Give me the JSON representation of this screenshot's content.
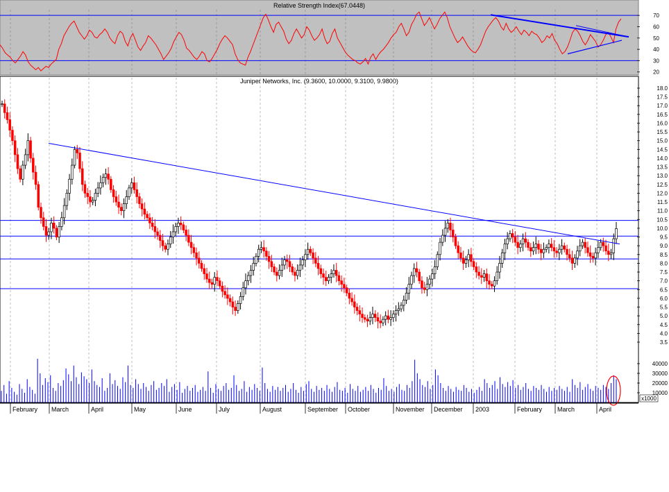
{
  "colors": {
    "background": "#ffffff",
    "rsi_panel_bg": "#c0c0c0",
    "rsi_line": "#ff0000",
    "blue_line": "#0000ff",
    "grid": "#a0a0a0",
    "candle_up": "#000000",
    "candle_down": "#ff0000",
    "volume_bar": "#0000ff",
    "highlight_ellipse": "#ff0000"
  },
  "chart_data": [
    {
      "type": "line",
      "title": "Relative Strength Index(67.0448)",
      "ylim": [
        18,
        75
      ],
      "y_ticks": [
        "70",
        "60",
        "50",
        "40",
        "30",
        "20"
      ],
      "y_tick_values": [
        70,
        60,
        50,
        40,
        30,
        20
      ],
      "reference_levels": [
        70,
        30
      ],
      "series": [
        {
          "values": [
            44,
            41,
            37,
            35,
            33,
            30,
            28,
            31,
            34,
            38,
            35,
            29,
            26,
            24,
            22,
            24,
            21,
            23,
            25,
            24,
            27,
            29,
            31,
            40,
            45,
            52,
            56,
            60,
            63,
            65,
            60,
            55,
            52,
            49,
            52,
            57,
            55,
            51,
            50,
            53,
            55,
            58,
            55,
            50,
            47,
            45,
            52,
            56,
            54,
            47,
            43,
            50,
            54,
            48,
            42,
            39,
            43,
            46,
            52,
            50,
            47,
            44,
            40,
            36,
            31,
            34,
            37,
            41,
            47,
            51,
            55,
            53,
            48,
            41,
            39,
            36,
            33,
            31,
            34,
            38,
            36,
            30,
            29,
            32,
            36,
            40,
            45,
            49,
            52,
            50,
            47,
            44,
            36,
            31,
            28,
            27,
            26,
            33,
            38,
            44,
            50,
            56,
            62,
            68,
            71,
            66,
            60,
            55,
            62,
            64,
            60,
            56,
            49,
            45,
            48,
            54,
            58,
            54,
            50,
            53,
            60,
            57,
            52,
            48,
            50,
            53,
            58,
            50,
            45,
            47,
            54,
            58,
            50,
            46,
            42,
            38,
            35,
            33,
            31,
            30,
            28,
            27,
            29,
            32,
            27,
            33,
            36,
            31,
            35,
            38,
            40,
            43,
            46,
            50,
            53,
            55,
            60,
            63,
            58,
            52,
            55,
            62,
            66,
            71,
            73,
            67,
            61,
            64,
            68,
            63,
            58,
            62,
            67,
            70,
            73,
            68,
            60,
            55,
            50,
            46,
            48,
            51,
            47,
            43,
            40,
            38,
            37,
            40,
            44,
            50,
            56,
            60,
            63,
            66,
            68,
            65,
            60,
            57,
            63,
            58,
            55,
            57,
            60,
            56,
            53,
            57,
            55,
            52,
            56,
            54,
            53,
            50,
            46,
            48,
            52,
            50,
            54,
            48,
            45,
            40,
            36,
            38,
            42,
            48,
            55,
            58,
            56,
            52,
            47,
            44,
            48,
            53,
            50,
            47,
            42,
            44,
            48,
            53,
            55,
            51,
            46,
            58,
            64,
            67
          ],
          "color": "#ff0000"
        }
      ]
    },
    {
      "type": "line",
      "title": "Juniper Networks, Inc. (9.3600, 10.0000, 9.3100, 9.9800)",
      "xlabel": "",
      "ylabel": "",
      "ylim": [
        3.0,
        18.5
      ],
      "y_ticks": [
        "18.0",
        "17.5",
        "17.0",
        "16.5",
        "16.0",
        "15.5",
        "15.0",
        "14.5",
        "14.0",
        "13.5",
        "13.0",
        "12.5",
        "12.0",
        "11.5",
        "11.0",
        "10.5",
        "10.0",
        "9.5",
        "9.0",
        "8.5",
        "8.0",
        "7.5",
        "7.0",
        "6.5",
        "6.0",
        "5.5",
        "5.0",
        "4.5",
        "4.0",
        "3.5"
      ],
      "y_tick_values": [
        18.0,
        17.5,
        17.0,
        16.5,
        16.0,
        15.5,
        15.0,
        14.5,
        14.0,
        13.5,
        13.0,
        12.5,
        12.0,
        11.5,
        11.0,
        10.5,
        10.0,
        9.5,
        9.0,
        8.5,
        8.0,
        7.5,
        7.0,
        6.5,
        6.0,
        5.5,
        5.0,
        4.5,
        4.0,
        3.5
      ],
      "x_ticks": [
        "February",
        "March",
        "April",
        "May",
        "June",
        "July",
        "August",
        "September",
        "October",
        "November",
        "December",
        "2003",
        "February",
        "March",
        "April"
      ],
      "horizontal_levels": [
        10.45,
        9.55,
        8.25,
        6.55
      ],
      "series": [
        {
          "name": "",
          "close": [
            17.1,
            16.6,
            16.2,
            15.6,
            15.0,
            14.2,
            13.4,
            12.8,
            13.6,
            14.2,
            15.0,
            14.0,
            13.2,
            12.5,
            11.2,
            10.6,
            10.1,
            9.6,
            9.8,
            10.3,
            10.0,
            9.5,
            10.1,
            10.6,
            11.3,
            12.0,
            12.8,
            13.6,
            14.5,
            14.3,
            13.4,
            12.5,
            12.0,
            11.8,
            11.5,
            11.6,
            12.0,
            12.3,
            12.6,
            12.9,
            13.1,
            12.8,
            12.2,
            11.8,
            11.5,
            11.2,
            11.0,
            11.4,
            11.8,
            12.3,
            12.6,
            12.2,
            11.8,
            11.4,
            11.1,
            10.8,
            10.6,
            10.3,
            10.1,
            9.8,
            9.6,
            9.3,
            9.0,
            8.8,
            9.1,
            9.5,
            9.8,
            10.1,
            10.3,
            10.2,
            9.9,
            9.6,
            9.2,
            8.9,
            8.6,
            8.3,
            8.0,
            7.7,
            7.4,
            7.1,
            6.9,
            6.8,
            7.2,
            7.0,
            6.7,
            6.4,
            6.2,
            6.0,
            5.8,
            5.5,
            5.3,
            5.7,
            6.1,
            6.6,
            7.0,
            7.3,
            7.6,
            8.0,
            8.4,
            8.8,
            8.9,
            8.7,
            8.4,
            8.1,
            7.8,
            7.5,
            7.3,
            7.6,
            7.9,
            8.2,
            8.1,
            7.8,
            7.5,
            7.3,
            7.6,
            7.9,
            8.2,
            8.5,
            8.8,
            8.6,
            8.3,
            8.0,
            7.7,
            7.4,
            7.2,
            7.0,
            7.2,
            7.4,
            7.6,
            7.3,
            7.0,
            6.8,
            6.6,
            6.3,
            6.0,
            5.8,
            5.5,
            5.3,
            5.1,
            4.9,
            4.8,
            4.7,
            4.9,
            5.1,
            4.9,
            4.7,
            4.6,
            4.8,
            5.0,
            4.8,
            4.9,
            5.1,
            5.3,
            5.4,
            5.6,
            5.9,
            6.3,
            6.8,
            7.3,
            7.7,
            7.5,
            7.0,
            6.6,
            6.5,
            6.8,
            7.1,
            7.4,
            7.8,
            8.5,
            9.2,
            9.6,
            10.0,
            10.3,
            9.9,
            9.5,
            9.0,
            8.6,
            8.3,
            8.0,
            8.2,
            8.5,
            8.1,
            7.8,
            7.5,
            7.3,
            7.2,
            7.4,
            7.0,
            6.8,
            6.7,
            7.0,
            7.5,
            8.0,
            8.6,
            9.1,
            9.4,
            9.7,
            9.5,
            9.2,
            8.9,
            9.1,
            9.4,
            9.2,
            8.9,
            8.7,
            8.9,
            9.1,
            8.8,
            8.6,
            8.8,
            8.9,
            9.1,
            8.9,
            8.7,
            8.6,
            8.8,
            9.0,
            8.8,
            8.5,
            8.3,
            8.0,
            8.3,
            8.7,
            9.0,
            9.2,
            8.9,
            8.6,
            8.4,
            8.3,
            8.6,
            8.9,
            9.2,
            9.0,
            8.7,
            8.5,
            8.6,
            9.4,
            9.98
          ],
          "color": "#000000"
        }
      ],
      "trendline": {
        "from_value": 14.85,
        "to_value": 9.1
      }
    },
    {
      "type": "bar",
      "title": "",
      "y_ticks": [
        "40000",
        "30000",
        "20000",
        "10000"
      ],
      "y_tick_values": [
        40000,
        30000,
        20000,
        10000
      ],
      "ylim": [
        0,
        50000
      ],
      "unit_label": "x1000",
      "values": [
        12000,
        18000,
        9000,
        22000,
        15000,
        11000,
        8000,
        19000,
        14000,
        10000,
        24000,
        16000,
        13000,
        9000,
        45000,
        30000,
        18000,
        25000,
        21000,
        28000,
        15000,
        12000,
        20000,
        17000,
        23000,
        35000,
        29000,
        22000,
        38000,
        26000,
        19000,
        31000,
        27000,
        24000,
        20000,
        34000,
        22000,
        18000,
        16000,
        25000,
        12000,
        15000,
        30000,
        19000,
        23000,
        17000,
        14000,
        26000,
        21000,
        38000,
        18000,
        15000,
        24000,
        19000,
        14000,
        20000,
        16000,
        12000,
        18000,
        22000,
        13000,
        15000,
        20000,
        17000,
        24000,
        11000,
        16000,
        19000,
        13000,
        21000,
        10000,
        14000,
        17000,
        12000,
        15000,
        18000,
        11000,
        13000,
        16000,
        12000,
        32000,
        15000,
        10000,
        19000,
        14000,
        12000,
        17000,
        20000,
        13000,
        15000,
        28000,
        18000,
        12000,
        14000,
        22000,
        11000,
        16000,
        13000,
        19000,
        15000,
        12000,
        36000,
        20000,
        14000,
        11000,
        17000,
        13000,
        16000,
        12000,
        15000,
        18000,
        11000,
        14000,
        20000,
        13000,
        10000,
        16000,
        12000,
        19000,
        22000,
        14000,
        11000,
        17000,
        13000,
        15000,
        12000,
        18000,
        14000,
        11000,
        16000,
        21000,
        13000,
        12000,
        15000,
        10000,
        19000,
        14000,
        12000,
        17000,
        11000,
        13000,
        16000,
        12000,
        18000,
        14000,
        10000,
        15000,
        13000,
        25000,
        17000,
        12000,
        14000,
        11000,
        16000,
        19000,
        13000,
        12000,
        18000,
        15000,
        22000,
        44000,
        30000,
        24000,
        18000,
        16000,
        22000,
        14000,
        18000,
        34000,
        28000,
        20000,
        15000,
        12000,
        17000,
        14000,
        11000,
        16000,
        13000,
        12000,
        18000,
        15000,
        11000,
        14000,
        10000,
        13000,
        16000,
        12000,
        24000,
        20000,
        15000,
        18000,
        22000,
        14000,
        26000,
        19000,
        16000,
        21000,
        17000,
        23000,
        15000,
        18000,
        13000,
        16000,
        20000,
        14000,
        12000,
        17000,
        15000,
        13000,
        18000,
        14000,
        11000,
        16000,
        12000,
        15000,
        13000,
        17000,
        14000,
        12000,
        16000,
        11000,
        24000,
        18000,
        15000,
        21000,
        13000,
        16000,
        19000,
        14000,
        12000,
        17000,
        15000,
        13000,
        18000,
        16000,
        14000,
        20000,
        28000,
        24000
      ],
      "series": [
        {
          "values": [],
          "color": "#0000ff"
        }
      ]
    }
  ]
}
